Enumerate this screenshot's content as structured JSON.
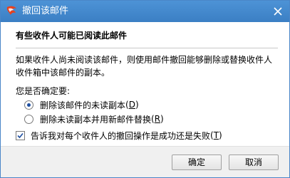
{
  "window": {
    "title": "撤回该邮件",
    "close_icon": "close-icon",
    "app_icon": "foxmail-logo-icon"
  },
  "heading": "有些收件人可能已阅读此邮件",
  "description": "如果收件人尚未阅读该邮件，则使用邮件撤回能够删除或替换收件人收件箱中该邮件的副本。",
  "question": "您是否确定要:",
  "options": [
    {
      "label": "删除该邮件的未读副本",
      "hotkey": "D",
      "selected": true
    },
    {
      "label": "删除未读副本并用新邮件替换",
      "hotkey": "R",
      "selected": false
    }
  ],
  "notify": {
    "label": "告诉我对每个收件人的撤回操作是成功还是失败",
    "hotkey": "T",
    "checked": true
  },
  "buttons": {
    "ok": "确定",
    "cancel": "取消"
  },
  "colors": {
    "titlebar": "#3f85c9",
    "accent": "#1f4fa0",
    "logo": "#e8401c"
  }
}
